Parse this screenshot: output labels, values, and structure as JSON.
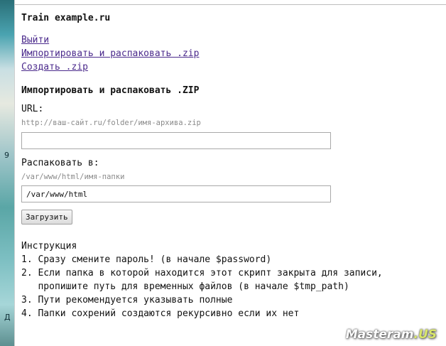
{
  "site_title": "Train example.ru",
  "nav": {
    "logout": "Выйти",
    "import_unpack": "Импортировать и распаковать .zip",
    "create_zip": "Создать .zip"
  },
  "section_title": "Импортировать и распаковать .ZIP",
  "url_field": {
    "label": "URL:",
    "hint": "http://ваш-сайт.ru/folder/имя-архива.zip",
    "value": ""
  },
  "unpack_field": {
    "label": "Распаковать в:",
    "hint": "/var/www/html/имя-папки",
    "value": "/var/www/html"
  },
  "submit_label": "Загрузить",
  "instructions": {
    "title": "Инструкция",
    "items": [
      "1. Сразу смените пароль! (в начале $password)",
      "2. Если папка в которой находится этот скрипт закрыта для записи,\n   пропишите путь для временных файлов (в начале $tmp_path)",
      "3. Пути рекомендуется указывать полные",
      "4. Папки сохрений создаются рекурсивно если их нет"
    ]
  },
  "watermark": {
    "brand": "Masteram",
    "tld": ".US"
  },
  "desktop_fragments": [
    "9",
    "Д"
  ]
}
